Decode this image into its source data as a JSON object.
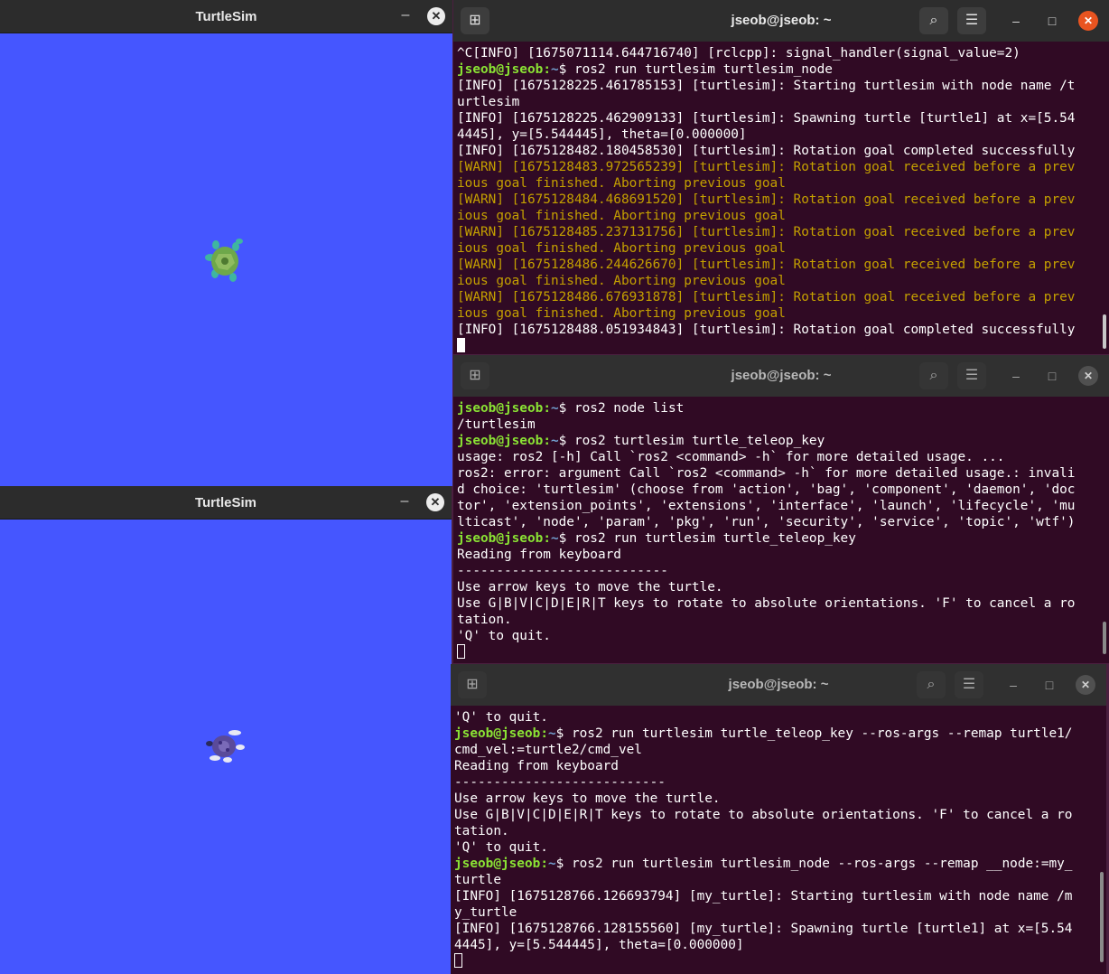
{
  "turtlesim_top": {
    "title": "TurtleSim",
    "min": "–",
    "close": "✕"
  },
  "turtlesim_bottom": {
    "title": "TurtleSim",
    "min": "–",
    "close": "✕"
  },
  "term1": {
    "title": "jseob@jseob: ~",
    "lines": [
      {
        "t": "^C[INFO] [1675071114.644716740] [rclcpp]: signal_handler(signal_value=2)"
      },
      {
        "user": "jseob@jseob",
        "path": "~",
        "t": "$ ros2 run turtlesim turtlesim_node"
      },
      {
        "t": "[INFO] [1675128225.461785153] [turtlesim]: Starting turtlesim with node name /t"
      },
      {
        "t": "urtlesim"
      },
      {
        "t": "[INFO] [1675128225.462909133] [turtlesim]: Spawning turtle [turtle1] at x=[5.54"
      },
      {
        "t": "4445], y=[5.544445], theta=[0.000000]"
      },
      {
        "t": "[INFO] [1675128482.180458530] [turtlesim]: Rotation goal completed successfully"
      },
      {
        "t": "[WARN] [1675128483.972565239] [turtlesim]: Rotation goal received before a prev",
        "warn": true
      },
      {
        "t": "ious goal finished. Aborting previous goal",
        "warn": true
      },
      {
        "t": "[WARN] [1675128484.468691520] [turtlesim]: Rotation goal received before a prev",
        "warn": true
      },
      {
        "t": "ious goal finished. Aborting previous goal",
        "warn": true
      },
      {
        "t": "[WARN] [1675128485.237131756] [turtlesim]: Rotation goal received before a prev",
        "warn": true
      },
      {
        "t": "ious goal finished. Aborting previous goal",
        "warn": true
      },
      {
        "t": "[WARN] [1675128486.244626670] [turtlesim]: Rotation goal received before a prev",
        "warn": true
      },
      {
        "t": "ious goal finished. Aborting previous goal",
        "warn": true
      },
      {
        "t": "[WARN] [1675128486.676931878] [turtlesim]: Rotation goal received before a prev",
        "warn": true
      },
      {
        "t": "ious goal finished. Aborting previous goal",
        "warn": true
      },
      {
        "t": "[INFO] [1675128488.051934843] [turtlesim]: Rotation goal completed successfully"
      },
      {
        "cursor": "solid"
      }
    ]
  },
  "term2": {
    "title": "jseob@jseob: ~",
    "lines": [
      {
        "user": "jseob@jseob",
        "path": "~",
        "t": "$ ros2 node list"
      },
      {
        "t": "/turtlesim"
      },
      {
        "user": "jseob@jseob",
        "path": "~",
        "t": "$ ros2 turtlesim turtle_teleop_key"
      },
      {
        "t": "usage: ros2 [-h] Call `ros2 <command> -h` for more detailed usage. ..."
      },
      {
        "t": "ros2: error: argument Call `ros2 <command> -h` for more detailed usage.: invali"
      },
      {
        "t": "d choice: 'turtlesim' (choose from 'action', 'bag', 'component', 'daemon', 'doc"
      },
      {
        "t": "tor', 'extension_points', 'extensions', 'interface', 'launch', 'lifecycle', 'mu"
      },
      {
        "t": "lticast', 'node', 'param', 'pkg', 'run', 'security', 'service', 'topic', 'wtf')"
      },
      {
        "user": "jseob@jseob",
        "path": "~",
        "t": "$ ros2 run turtlesim turtle_teleop_key"
      },
      {
        "t": "Reading from keyboard"
      },
      {
        "t": "---------------------------"
      },
      {
        "t": "Use arrow keys to move the turtle."
      },
      {
        "t": "Use G|B|V|C|D|E|R|T keys to rotate to absolute orientations. 'F' to cancel a ro"
      },
      {
        "t": "tation."
      },
      {
        "t": "'Q' to quit."
      },
      {
        "cursor": "hollow"
      }
    ]
  },
  "term3": {
    "title": "jseob@jseob: ~",
    "lines": [
      {
        "t": "'Q' to quit."
      },
      {
        "user": "jseob@jseob",
        "path": "~",
        "t": "$ ros2 run turtlesim turtle_teleop_key --ros-args --remap turtle1/"
      },
      {
        "t": "cmd_vel:=turtle2/cmd_vel"
      },
      {
        "t": "Reading from keyboard"
      },
      {
        "t": "---------------------------"
      },
      {
        "t": "Use arrow keys to move the turtle."
      },
      {
        "t": "Use G|B|V|C|D|E|R|T keys to rotate to absolute orientations. 'F' to cancel a ro"
      },
      {
        "t": "tation."
      },
      {
        "t": "'Q' to quit."
      },
      {
        "user": "jseob@jseob",
        "path": "~",
        "t": "$ ros2 run turtlesim turtlesim_node --ros-args --remap __node:=my_"
      },
      {
        "t": "turtle"
      },
      {
        "t": "[INFO] [1675128766.126693794] [my_turtle]: Starting turtlesim with node name /m"
      },
      {
        "t": "y_turtle"
      },
      {
        "t": "[INFO] [1675128766.128155560] [my_turtle]: Spawning turtle [turtle1] at x=[5.54"
      },
      {
        "t": "4445], y=[5.544445], theta=[0.000000]"
      },
      {
        "cursor": "hollow"
      }
    ]
  },
  "term_controls": {
    "new_tab": "⊞",
    "search": "⌕",
    "menu": "☰",
    "minimize": "–",
    "maximize": "□",
    "close": "✕"
  },
  "colors": {
    "canvas": "#4556ff",
    "terminal_bg": "#300a24",
    "prompt_user": "#8ae234",
    "prompt_path": "#729fcf",
    "warn": "#c4a000",
    "close_active": "#e95420"
  }
}
